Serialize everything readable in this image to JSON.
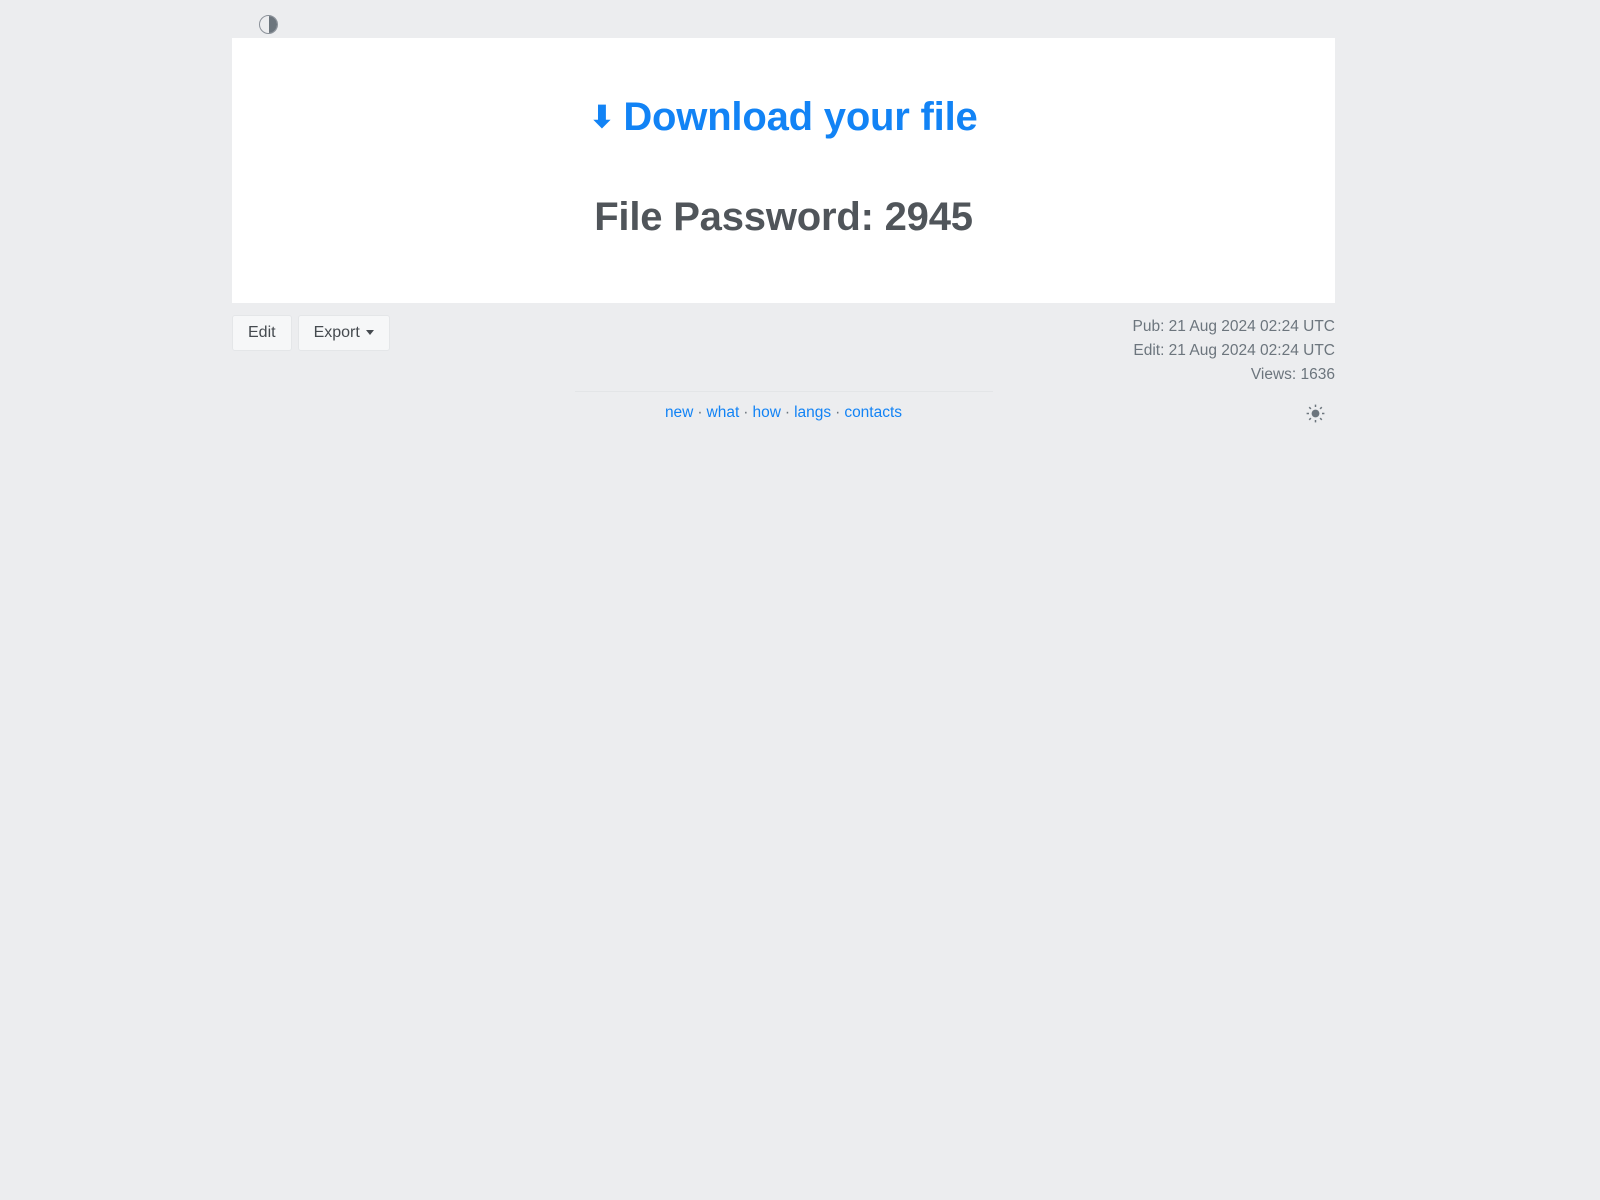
{
  "theme_toggle": {
    "icon": "half-circle-contrast-icon",
    "label": "Toggle dark mode"
  },
  "card": {
    "download": {
      "arrow_glyph": "⬇",
      "label": "Download your file",
      "color": "#1283f5"
    },
    "password": {
      "label": "File Password: 2945",
      "color": "#50555a"
    }
  },
  "toolbar": {
    "edit_label": "Edit",
    "export_label": "Export",
    "export_caret": "caret-down-icon"
  },
  "meta": {
    "published": "Pub: 21 Aug 2024 02:24 UTC",
    "edited": "Edit: 21 Aug 2024 02:24 UTC",
    "views": "Views: 1636"
  },
  "footer": {
    "links": [
      {
        "label": "new"
      },
      {
        "label": "what"
      },
      {
        "label": "how"
      },
      {
        "label": "langs"
      },
      {
        "label": "contacts"
      }
    ],
    "separator": "·",
    "light_toggle": {
      "icon": "sun-icon",
      "label": "Light mode"
    }
  },
  "colors": {
    "page_background": "#ecedef",
    "card_background": "#ffffff",
    "accent_blue": "#1283f5",
    "muted_text": "#6c757d",
    "dark_text": "#50555a"
  }
}
